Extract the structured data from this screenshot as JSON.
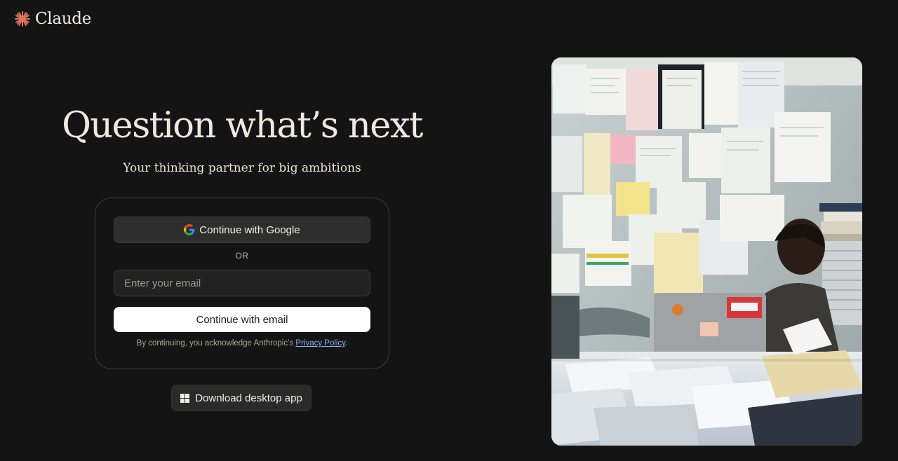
{
  "brand": {
    "name": "Claude",
    "logo_icon": "claude-spark-icon",
    "accent": "#d97757"
  },
  "hero": {
    "title": "Question what’s next",
    "subtitle": "Your thinking partner for big ambitions"
  },
  "auth": {
    "google_button_label": "Continue with Google",
    "google_icon": "google-g-icon",
    "divider": "OR",
    "email_placeholder": "Enter your email",
    "email_value": "",
    "email_button_label": "Continue with email",
    "legal_prefix": "By continuing, you acknowledge Anthropic’s ",
    "legal_link": "Privacy Policy",
    "legal_suffix": "."
  },
  "download": {
    "label": "Download desktop app",
    "icon": "windows-icon"
  },
  "colors": {
    "background": "#141414",
    "link": "#8bb5f7",
    "primary_button": "#ffffff"
  }
}
